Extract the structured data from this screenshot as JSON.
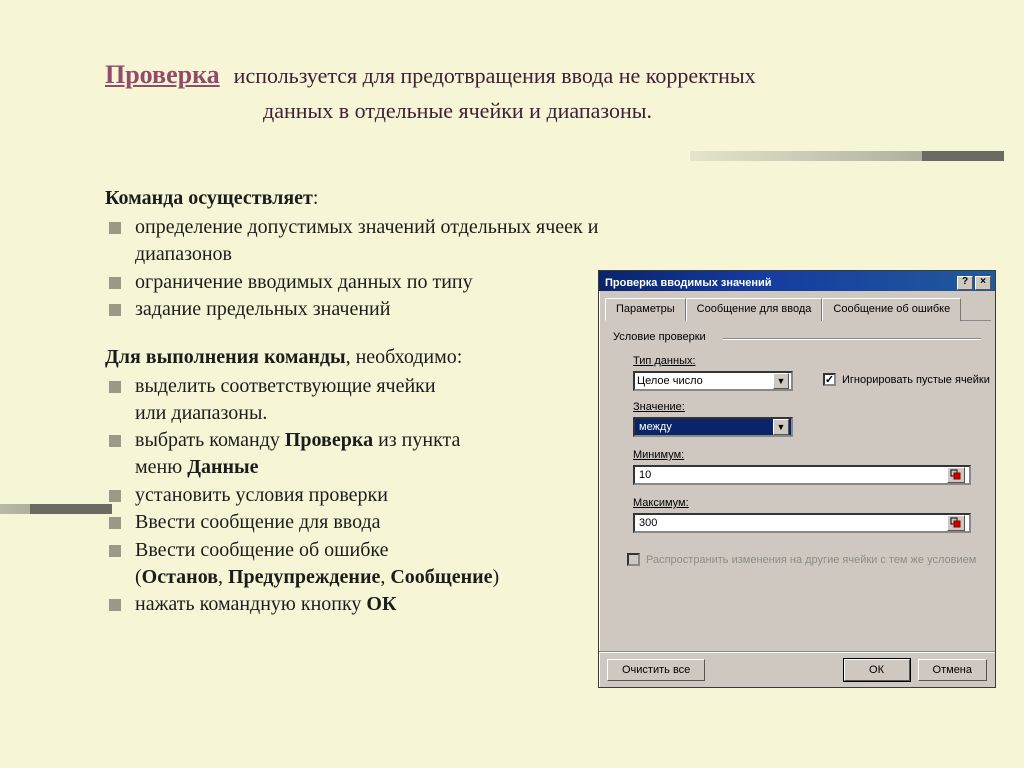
{
  "header": {
    "title": "Проверка",
    "desc_first": "используется для предотвращения ввода не корректных",
    "desc_second": "данных в отдельные ячейки и диапазоны."
  },
  "section1": {
    "heading": "Команда осуществляет",
    "colon": ":",
    "items": [
      "определение допустимых значений отдельных ячеек и   диапазонов",
      "ограничение вводимых данных по типу",
      "задание предельных значений"
    ]
  },
  "section2": {
    "heading": "Для выполнения команды",
    "after": ", необходимо:",
    "items": [
      {
        "text": "выделить соответствующие ячейки",
        "extra": "или диапазоны."
      },
      {
        "prefix": "выбрать команду ",
        "bold1": "Проверка",
        "mid": " из пункта",
        "line2_prefix": "меню ",
        "bold2": "Данные"
      },
      {
        "text": "установить условия проверки"
      },
      {
        "text": "Ввести сообщение для ввода"
      },
      {
        "text": "Ввести сообщение об ошибке",
        "extra_prefix": "(",
        "b1": "Останов",
        "c1": ", ",
        "b2": "Предупреждение",
        "c2": ", ",
        "b3": "Сообщение",
        "extra_suffix": ")"
      },
      {
        "prefix": "нажать командную кнопку ",
        "bold1": "ОК"
      }
    ]
  },
  "dialog": {
    "title": "Проверка вводимых значений",
    "help": "?",
    "close": "×",
    "tabs": [
      "Параметры",
      "Сообщение для ввода",
      "Сообщение об ошибке"
    ],
    "group_label": "Условие проверки",
    "labels": {
      "type": "Тип данных:",
      "value": "Значение:",
      "min": "Минимум:",
      "max": "Максимум:"
    },
    "values": {
      "type": "Целое число",
      "value": "между",
      "min": "10",
      "max": "300"
    },
    "checks": {
      "ignore": "Игнорировать пустые ячейки",
      "propagate": "Распространить изменения на другие ячейки с тем же условием"
    },
    "buttons": {
      "clear": "Очистить все",
      "ok": "ОК",
      "cancel": "Отмена"
    }
  }
}
